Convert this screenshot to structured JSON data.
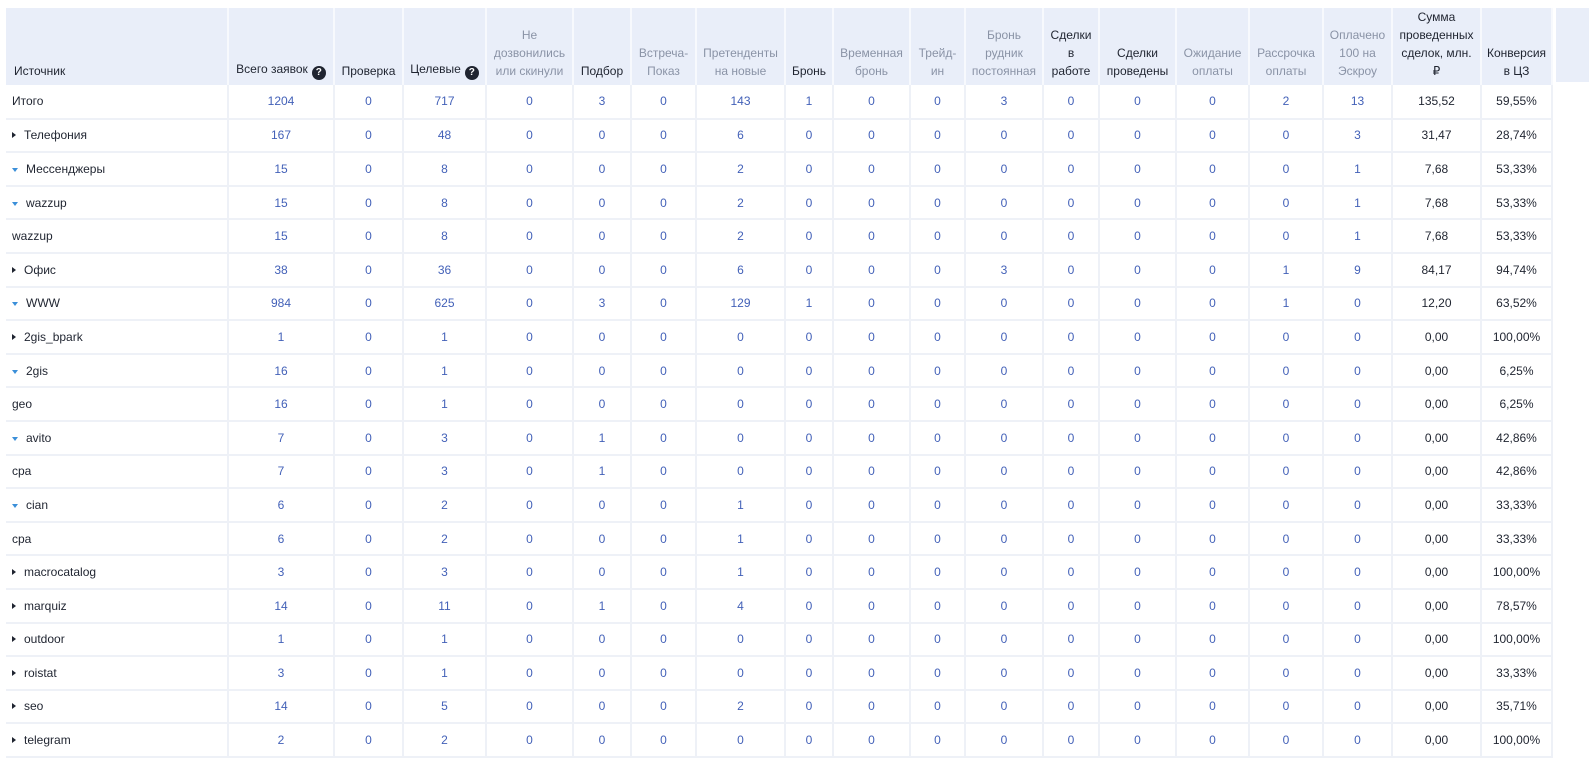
{
  "header": {
    "columns": [
      {
        "key": "source",
        "label": "Источник",
        "style": "dark"
      },
      {
        "key": "total",
        "label": "Всего заявок",
        "style": "dark",
        "help": true
      },
      {
        "key": "check",
        "label": "Проверка",
        "style": "dark"
      },
      {
        "key": "target",
        "label": "Целевые",
        "style": "dark",
        "help": true
      },
      {
        "key": "no_answer",
        "label": "Не дозвонились или скинули",
        "style": "muted"
      },
      {
        "key": "selection",
        "label": "Подбор",
        "style": "dark"
      },
      {
        "key": "meeting",
        "label": "Встреча-Показ",
        "style": "muted"
      },
      {
        "key": "applicants",
        "label": "Претенденты на новые",
        "style": "muted"
      },
      {
        "key": "booking",
        "label": "Бронь",
        "style": "dark"
      },
      {
        "key": "temp_booking",
        "label": "Временная бронь",
        "style": "muted"
      },
      {
        "key": "trade_in",
        "label": "Трейд-ин",
        "style": "muted"
      },
      {
        "key": "perm_booking",
        "label": "Бронь рудник постоянная",
        "style": "muted"
      },
      {
        "key": "deals_in_work",
        "label": "Сделки в работе",
        "style": "dark"
      },
      {
        "key": "deals_done",
        "label": "Сделки проведены",
        "style": "dark"
      },
      {
        "key": "awaiting_payment",
        "label": "Ожидание оплаты",
        "style": "muted"
      },
      {
        "key": "installment",
        "label": "Рассрочка оплаты",
        "style": "muted"
      },
      {
        "key": "escrow_paid",
        "label": "Оплачено 100 на Эскроу",
        "style": "muted"
      },
      {
        "key": "deals_sum",
        "label": "Сумма проведенных сделок, млн. ₽",
        "style": "dark"
      },
      {
        "key": "conversion",
        "label": "Конверсия в ЦЗ",
        "style": "dark"
      }
    ]
  },
  "rows": [
    {
      "name": "Итого",
      "level": 0,
      "toggle": "none",
      "values": [
        "1204",
        "0",
        "717",
        "0",
        "3",
        "0",
        "143",
        "1",
        "0",
        "0",
        "3",
        "0",
        "0",
        "0",
        "2",
        "13",
        "135,52",
        "59,55%"
      ]
    },
    {
      "name": "Телефония",
      "level": 1,
      "toggle": "collapsed",
      "values": [
        "167",
        "0",
        "48",
        "0",
        "0",
        "0",
        "6",
        "0",
        "0",
        "0",
        "0",
        "0",
        "0",
        "0",
        "0",
        "3",
        "31,47",
        "28,74%"
      ]
    },
    {
      "name": "Мессенджеры",
      "level": 1,
      "toggle": "expanded",
      "values": [
        "15",
        "0",
        "8",
        "0",
        "0",
        "0",
        "2",
        "0",
        "0",
        "0",
        "0",
        "0",
        "0",
        "0",
        "0",
        "1",
        "7,68",
        "53,33%"
      ]
    },
    {
      "name": "wazzup",
      "level": 2,
      "toggle": "expanded",
      "values": [
        "15",
        "0",
        "8",
        "0",
        "0",
        "0",
        "2",
        "0",
        "0",
        "0",
        "0",
        "0",
        "0",
        "0",
        "0",
        "1",
        "7,68",
        "53,33%"
      ]
    },
    {
      "name": "wazzup",
      "level": 3,
      "toggle": "none",
      "values": [
        "15",
        "0",
        "8",
        "0",
        "0",
        "0",
        "2",
        "0",
        "0",
        "0",
        "0",
        "0",
        "0",
        "0",
        "0",
        "1",
        "7,68",
        "53,33%"
      ]
    },
    {
      "name": "Офис",
      "level": 1,
      "toggle": "collapsed",
      "values": [
        "38",
        "0",
        "36",
        "0",
        "0",
        "0",
        "6",
        "0",
        "0",
        "0",
        "3",
        "0",
        "0",
        "0",
        "1",
        "9",
        "84,17",
        "94,74%"
      ]
    },
    {
      "name": "WWW",
      "level": 1,
      "toggle": "expanded",
      "values": [
        "984",
        "0",
        "625",
        "0",
        "3",
        "0",
        "129",
        "1",
        "0",
        "0",
        "0",
        "0",
        "0",
        "0",
        "1",
        "0",
        "12,20",
        "63,52%"
      ]
    },
    {
      "name": "2gis_bpark",
      "level": 2,
      "toggle": "collapsed",
      "values": [
        "1",
        "0",
        "1",
        "0",
        "0",
        "0",
        "0",
        "0",
        "0",
        "0",
        "0",
        "0",
        "0",
        "0",
        "0",
        "0",
        "0,00",
        "100,00%"
      ]
    },
    {
      "name": "2gis",
      "level": 2,
      "toggle": "expanded",
      "values": [
        "16",
        "0",
        "1",
        "0",
        "0",
        "0",
        "0",
        "0",
        "0",
        "0",
        "0",
        "0",
        "0",
        "0",
        "0",
        "0",
        "0,00",
        "6,25%"
      ]
    },
    {
      "name": "geo",
      "level": 3,
      "toggle": "none",
      "values": [
        "16",
        "0",
        "1",
        "0",
        "0",
        "0",
        "0",
        "0",
        "0",
        "0",
        "0",
        "0",
        "0",
        "0",
        "0",
        "0",
        "0,00",
        "6,25%"
      ]
    },
    {
      "name": "avito",
      "level": 2,
      "toggle": "expanded",
      "values": [
        "7",
        "0",
        "3",
        "0",
        "1",
        "0",
        "0",
        "0",
        "0",
        "0",
        "0",
        "0",
        "0",
        "0",
        "0",
        "0",
        "0,00",
        "42,86%"
      ]
    },
    {
      "name": "cpa",
      "level": 3,
      "toggle": "none",
      "values": [
        "7",
        "0",
        "3",
        "0",
        "1",
        "0",
        "0",
        "0",
        "0",
        "0",
        "0",
        "0",
        "0",
        "0",
        "0",
        "0",
        "0,00",
        "42,86%"
      ]
    },
    {
      "name": "cian",
      "level": 2,
      "toggle": "expanded",
      "values": [
        "6",
        "0",
        "2",
        "0",
        "0",
        "0",
        "1",
        "0",
        "0",
        "0",
        "0",
        "0",
        "0",
        "0",
        "0",
        "0",
        "0,00",
        "33,33%"
      ]
    },
    {
      "name": "cpa",
      "level": 3,
      "toggle": "none",
      "values": [
        "6",
        "0",
        "2",
        "0",
        "0",
        "0",
        "1",
        "0",
        "0",
        "0",
        "0",
        "0",
        "0",
        "0",
        "0",
        "0",
        "0,00",
        "33,33%"
      ]
    },
    {
      "name": "macrocatalog",
      "level": 2,
      "toggle": "collapsed",
      "values": [
        "3",
        "0",
        "3",
        "0",
        "0",
        "0",
        "1",
        "0",
        "0",
        "0",
        "0",
        "0",
        "0",
        "0",
        "0",
        "0",
        "0,00",
        "100,00%"
      ]
    },
    {
      "name": "marquiz",
      "level": 2,
      "toggle": "collapsed",
      "values": [
        "14",
        "0",
        "11",
        "0",
        "1",
        "0",
        "4",
        "0",
        "0",
        "0",
        "0",
        "0",
        "0",
        "0",
        "0",
        "0",
        "0,00",
        "78,57%"
      ]
    },
    {
      "name": "outdoor",
      "level": 2,
      "toggle": "collapsed",
      "values": [
        "1",
        "0",
        "1",
        "0",
        "0",
        "0",
        "0",
        "0",
        "0",
        "0",
        "0",
        "0",
        "0",
        "0",
        "0",
        "0",
        "0,00",
        "100,00%"
      ]
    },
    {
      "name": "roistat",
      "level": 2,
      "toggle": "collapsed",
      "values": [
        "3",
        "0",
        "1",
        "0",
        "0",
        "0",
        "0",
        "0",
        "0",
        "0",
        "0",
        "0",
        "0",
        "0",
        "0",
        "0",
        "0,00",
        "33,33%"
      ]
    },
    {
      "name": "seo",
      "level": 2,
      "toggle": "collapsed",
      "values": [
        "14",
        "0",
        "5",
        "0",
        "0",
        "0",
        "2",
        "0",
        "0",
        "0",
        "0",
        "0",
        "0",
        "0",
        "0",
        "0",
        "0,00",
        "35,71%"
      ]
    },
    {
      "name": "telegram",
      "level": 2,
      "toggle": "collapsed",
      "values": [
        "2",
        "0",
        "2",
        "0",
        "0",
        "0",
        "0",
        "0",
        "0",
        "0",
        "0",
        "0",
        "0",
        "0",
        "0",
        "0",
        "0,00",
        "100,00%"
      ]
    }
  ],
  "colors": {
    "header_bg": "#e9eef9",
    "link_value": "#4361b8",
    "muted_header": "#8a93a6",
    "expand_icon": "#3b8fd9"
  }
}
